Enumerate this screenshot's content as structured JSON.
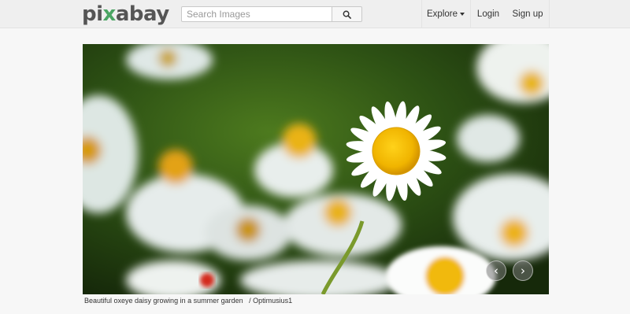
{
  "header": {
    "logo": {
      "prefix": "pi",
      "mid": "x",
      "suffix": "abay"
    },
    "search": {
      "placeholder": "Search Images",
      "value": ""
    },
    "nav": {
      "explore": "Explore",
      "login": "Login",
      "signup": "Sign up"
    }
  },
  "photo": {
    "description": "Beautiful oxeye daisy growing in a summer garden",
    "separator": "/",
    "author": "Optimusius1"
  },
  "colors": {
    "accent": "#4aa563",
    "topbar": "#efefef",
    "background": "#f7f7f7"
  },
  "icons": {
    "search": "search-icon",
    "prev": "chevron-left-icon",
    "next": "chevron-right-icon",
    "explore_caret": "caret-down-icon"
  }
}
